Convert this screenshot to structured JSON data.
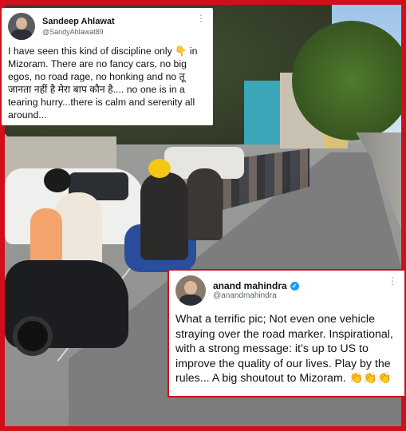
{
  "tweet_top": {
    "name": "Sandeep Ahlawat",
    "handle": "@SandyAhlawat89",
    "text": "I have seen this kind of discipline only 👇 in Mizoram. There are no fancy cars, no big egos, no road rage, no honking and no तू जानता नहीं है मेरा बाप कौन है.... no one is in a tearing hurry...there is calm and serenity all around...",
    "more_icon": "more-dots-icon"
  },
  "tweet_bottom": {
    "name": "anand mahindra",
    "handle": "@anandmahindra",
    "verified_icon": "verified-badge-icon",
    "text": "What a terrific pic; Not even one vehicle straying over the road marker. Inspirational, with a strong message: it’s up to US to improve the quality of our lives. Play by the rules... A big shoutout to Mizoram. 👏👏👏",
    "more_icon": "more-dots-icon"
  },
  "colors": {
    "frame": "#d10f1a",
    "card": "#ffffff",
    "verified": "#1d9bf0"
  }
}
